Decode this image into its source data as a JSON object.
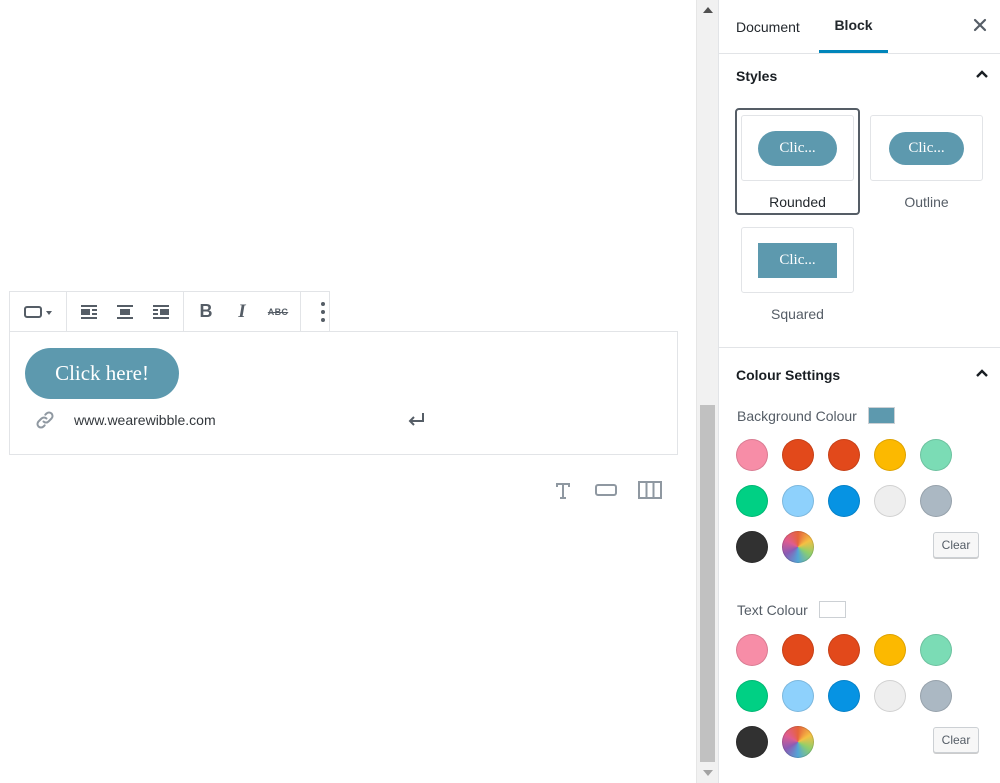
{
  "toolbar": {
    "buttons": [
      "block-type",
      "align-left",
      "align-center",
      "align-right",
      "bold",
      "italic",
      "strikethrough",
      "more-options"
    ],
    "bold_label": "B",
    "italic_label": "I",
    "strike_label": "ABC"
  },
  "block": {
    "button_text": "Click here!",
    "url": "www.wearewibble.com",
    "button_color": "#5d99ae"
  },
  "inserter": {
    "items": [
      "paragraph-icon",
      "button-icon",
      "columns-icon"
    ]
  },
  "sidebar": {
    "tabs": [
      {
        "label": "Document",
        "active": false
      },
      {
        "label": "Block",
        "active": true
      }
    ],
    "styles": {
      "title": "Styles",
      "options": [
        {
          "preview": "Clic...",
          "label": "Rounded",
          "selected": true
        },
        {
          "preview": "Clic...",
          "label": "Outline",
          "selected": false
        },
        {
          "preview": "Clic...",
          "label": "Squared",
          "selected": false
        }
      ]
    },
    "colour_settings": {
      "title": "Colour Settings",
      "background": {
        "label": "Background Colour",
        "current": "#5d99ae",
        "clear_label": "Clear"
      },
      "text": {
        "label": "Text Colour",
        "current": "#ffffff",
        "clear_label": "Clear"
      },
      "palette": [
        "#f78da7",
        "#e2491b",
        "#e2491b",
        "#fcb900",
        "#7bdcb5",
        "#00d084",
        "#8ed1fc",
        "#0693e3",
        "#eeeeee",
        "#abb8c3",
        "#313131",
        "custom-gradient"
      ]
    }
  }
}
